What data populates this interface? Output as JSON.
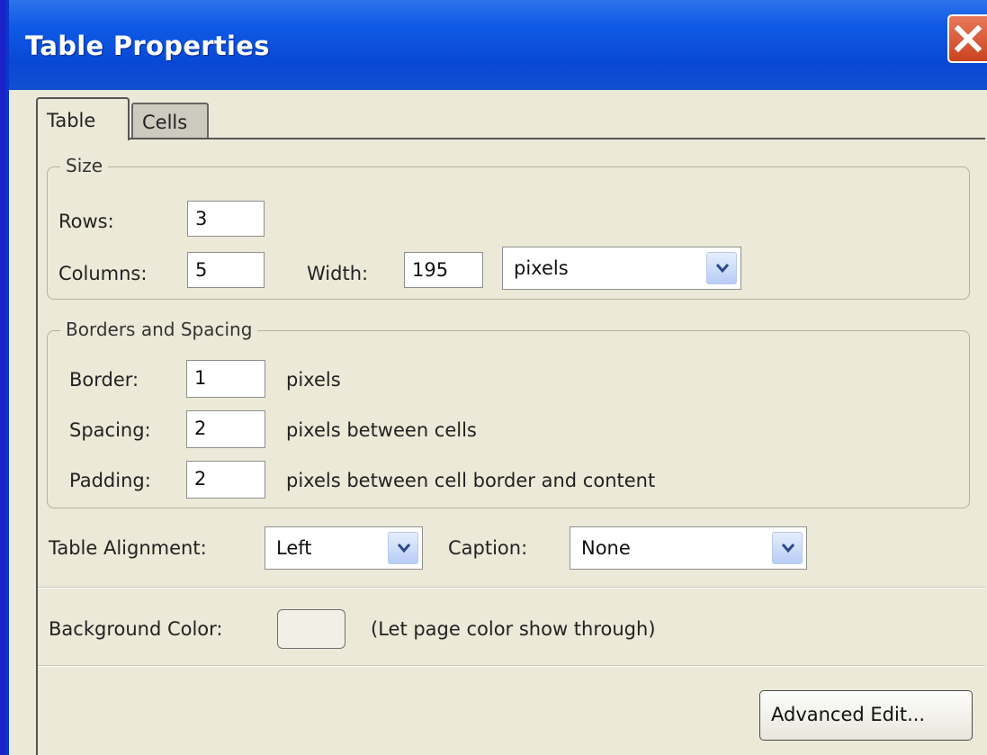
{
  "window": {
    "title": "Table Properties"
  },
  "tabs": [
    "Table",
    "Cells"
  ],
  "size_group": {
    "legend": "Size",
    "rows_label": "Rows:",
    "rows_value": "3",
    "columns_label": "Columns:",
    "columns_value": "5",
    "width_label": "Width:",
    "width_value": "195",
    "width_unit": "pixels"
  },
  "borders_group": {
    "legend": "Borders and Spacing",
    "border_label": "Border:",
    "border_value": "1",
    "border_unit": "pixels",
    "spacing_label": "Spacing:",
    "spacing_value": "2",
    "spacing_unit": "pixels between cells",
    "padding_label": "Padding:",
    "padding_value": "2",
    "padding_unit": "pixels between cell border and content"
  },
  "alignment": {
    "label": "Table Alignment:",
    "value": "Left",
    "caption_label": "Caption:",
    "caption_value": "None"
  },
  "background": {
    "label": "Background Color:",
    "note": "(Let page color show through)"
  },
  "buttons": {
    "advanced_edit": "Advanced Edit..."
  },
  "colors": {
    "desktop": "#1a22c8",
    "titlebar": "#0f5ae6",
    "dialog_bg": "#ece9d8",
    "close": "#c9431f"
  },
  "icons": [
    "close-icon",
    "chevron-down-icon"
  ]
}
